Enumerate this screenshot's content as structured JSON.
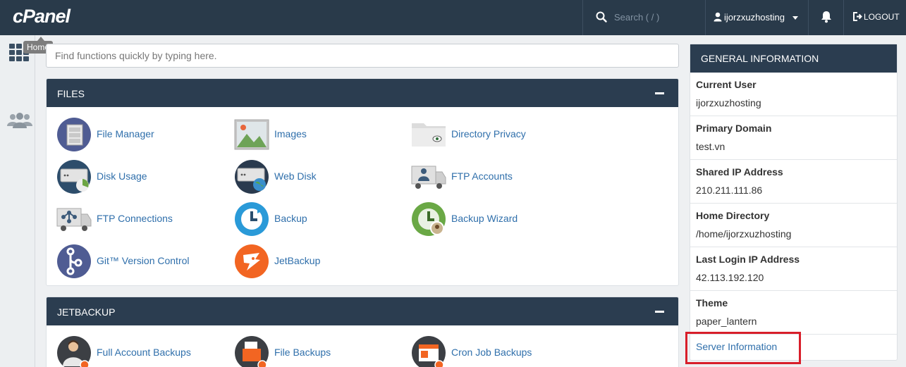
{
  "topbar": {
    "logo": "cPanel",
    "search_placeholder": "Search ( / )",
    "username": "ijorzxuzhosting",
    "logout_label": "LOGOUT"
  },
  "sidebar": {
    "home_tooltip": "Home"
  },
  "quickfind": {
    "placeholder": "Find functions quickly by typing here."
  },
  "panels": {
    "files": {
      "title": "FILES",
      "items": [
        {
          "label": "File Manager",
          "icon": "file-manager-icon"
        },
        {
          "label": "Images",
          "icon": "images-icon"
        },
        {
          "label": "Directory Privacy",
          "icon": "directory-privacy-icon"
        },
        {
          "label": "Disk Usage",
          "icon": "disk-usage-icon"
        },
        {
          "label": "Web Disk",
          "icon": "web-disk-icon"
        },
        {
          "label": "FTP Accounts",
          "icon": "ftp-accounts-icon"
        },
        {
          "label": "FTP Connections",
          "icon": "ftp-connections-icon"
        },
        {
          "label": "Backup",
          "icon": "backup-icon"
        },
        {
          "label": "Backup Wizard",
          "icon": "backup-wizard-icon"
        },
        {
          "label": "Git™ Version Control",
          "icon": "git-icon"
        },
        {
          "label": "JetBackup",
          "icon": "jetbackup-icon"
        }
      ]
    },
    "jetbackup": {
      "title": "JETBACKUP",
      "items": [
        {
          "label": "Full Account Backups",
          "icon": "full-account-backups-icon"
        },
        {
          "label": "File Backups",
          "icon": "file-backups-icon"
        },
        {
          "label": "Cron Job Backups",
          "icon": "cron-job-backups-icon"
        }
      ]
    }
  },
  "general_info": {
    "title": "GENERAL INFORMATION",
    "rows": [
      {
        "key": "Current User",
        "value": "ijorzxuzhosting"
      },
      {
        "key": "Primary Domain",
        "value": "test.vn"
      },
      {
        "key": "Shared IP Address",
        "value": "210.211.111.86"
      },
      {
        "key": "Home Directory",
        "value": "/home/ijorzxuzhosting"
      },
      {
        "key": "Last Login IP Address",
        "value": "42.113.192.120"
      },
      {
        "key": "Theme",
        "value": "paper_lantern"
      }
    ],
    "server_info_link": "Server Information"
  },
  "colors": {
    "topbar": "#293a4a",
    "panel_header": "#2b3d50",
    "link": "#2f6fab",
    "highlight": "#d81e2a"
  }
}
